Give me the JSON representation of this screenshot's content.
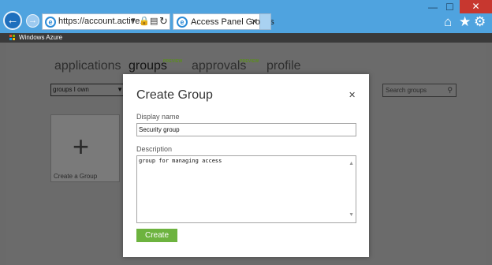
{
  "browser": {
    "url": "https://account.active...",
    "tab_title": "Access Panel Groups",
    "tab_close": "✕",
    "window_controls": {
      "minimize": "—",
      "maximize": "☐",
      "close": "✕"
    },
    "toolbar_icons": [
      "home-icon",
      "favorites-star-icon",
      "settings-gear-icon"
    ]
  },
  "azure_bar": {
    "label": "Windows Azure"
  },
  "nav": {
    "items": [
      {
        "label": "applications"
      },
      {
        "label": "groups",
        "badge": "PREVIEW"
      },
      {
        "label": "approvals",
        "badge": "PREVIEW"
      },
      {
        "label": "profile"
      }
    ],
    "active": "groups"
  },
  "filter": {
    "selected": "groups I own"
  },
  "search": {
    "placeholder": "Search groups"
  },
  "tile": {
    "label": "Create a Group"
  },
  "dialog": {
    "title": "Create Group",
    "close": "✕",
    "display_name_label": "Display name",
    "display_name_value": "Security group",
    "description_label": "Description",
    "description_value": "group for managing access",
    "create_button": "Create"
  },
  "colors": {
    "chrome_blue": "#4fa3df",
    "close_red": "#c7372f",
    "preview_green": "#5a8f1a",
    "create_green": "#6db33f"
  }
}
